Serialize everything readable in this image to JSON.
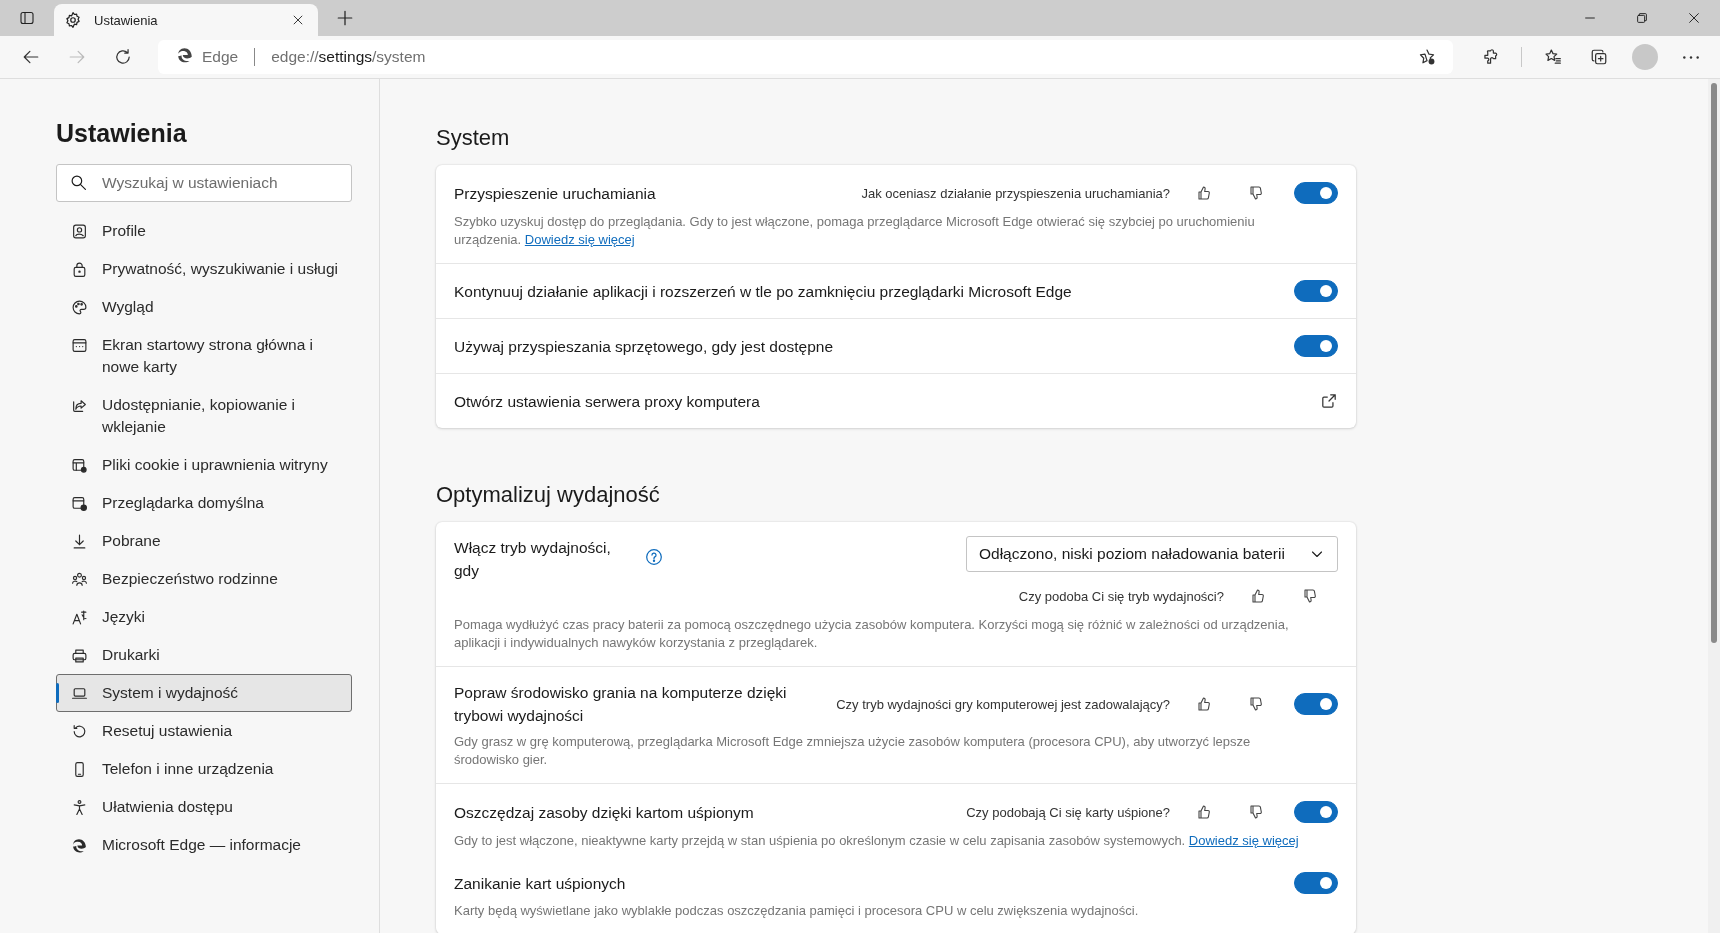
{
  "tab": {
    "title": "Ustawienia",
    "selected": true
  },
  "address_bar": {
    "site_label": "Edge",
    "url_prefix": "edge://",
    "url_host": "settings",
    "url_path": "/system"
  },
  "sidebar": {
    "title": "Ustawienia",
    "search": {
      "placeholder": "Wyszukaj w ustawieniach"
    },
    "items": [
      {
        "label": "Profile",
        "selected": false
      },
      {
        "label": "Prywatność, wyszukiwanie i usługi",
        "selected": false
      },
      {
        "label": "Wygląd",
        "selected": false
      },
      {
        "label": "Ekran startowy strona główna i nowe karty",
        "selected": false
      },
      {
        "label": "Udostępnianie, kopiowanie i wklejanie",
        "selected": false
      },
      {
        "label": "Pliki cookie i uprawnienia witryny",
        "selected": false
      },
      {
        "label": "Przeglądarka domyślna",
        "selected": false
      },
      {
        "label": "Pobrane",
        "selected": false
      },
      {
        "label": "Bezpieczeństwo rodzinne",
        "selected": false
      },
      {
        "label": "Języki",
        "selected": false
      },
      {
        "label": "Drukarki",
        "selected": false
      },
      {
        "label": "System i wydajność",
        "selected": true
      },
      {
        "label": "Resetuj ustawienia",
        "selected": false
      },
      {
        "label": "Telefon i inne urządzenia",
        "selected": false
      },
      {
        "label": "Ułatwienia dostępu",
        "selected": false
      },
      {
        "label": "Microsoft Edge — informacje",
        "selected": false
      }
    ]
  },
  "sections": [
    {
      "title": "System",
      "settings": [
        {
          "kind": "toggle",
          "title": "Przyspieszenie uruchamiania",
          "question": "Jak oceniasz działanie przyspieszenia uruchamiania?",
          "on": true,
          "description": "Szybko uzyskuj dostęp do przeglądania. Gdy to jest włączone, pomaga przeglądarce Microsoft Edge otwierać się szybciej po uruchomieniu urządzenia.",
          "link": "Dowiedz się więcej"
        },
        {
          "kind": "toggle",
          "title": "Kontynuuj działanie aplikacji i rozszerzeń w tle po zamknięciu przeglądarki Microsoft Edge",
          "on": true
        },
        {
          "kind": "toggle",
          "title": "Używaj przyspieszania sprzętowego, gdy jest dostępne",
          "on": true
        },
        {
          "kind": "external",
          "title": "Otwórz ustawienia serwera proxy komputera"
        }
      ]
    },
    {
      "title": "Optymalizuj wydajność",
      "settings": [
        {
          "kind": "dropdown",
          "title": "Włącz tryb wydajności, gdy",
          "value": "Odłączono, niski poziom naładowania baterii",
          "question": "Czy podoba Ci się tryb wydajności?",
          "description": "Pomaga wydłużyć czas pracy baterii za pomocą oszczędnego użycia zasobów komputera. Korzyści mogą się różnić w zależności od urządzenia, aplikacji i indywidualnych nawyków korzystania z przeglądarek."
        },
        {
          "kind": "toggle",
          "title": "Popraw środowisko grania na komputerze dzięki trybowi wydajności",
          "question": "Czy tryb wydajności gry komputerowej jest zadowalający?",
          "on": true,
          "description": "Gdy grasz w grę komputerową, przeglądarka Microsoft Edge zmniejsza użycie zasobów komputera (procesora CPU), aby utworzyć lepsze środowisko gier."
        },
        {
          "kind": "toggle",
          "title": "Oszczędzaj zasoby dzięki kartom uśpionym",
          "question": "Czy podobają Ci się karty uśpione?",
          "on": true,
          "description": "Gdy to jest włączone, nieaktywne karty przejdą w stan uśpienia po określonym czasie w celu zapisania zasobów systemowych.",
          "link": "Dowiedz się więcej"
        },
        {
          "kind": "subtoggle",
          "title": "Zanikanie kart uśpionych",
          "on": true,
          "description": "Karty będą wyświetlane jako wyblakłe podczas oszczędzania pamięci i procesora CPU w celu zwiększenia wydajności."
        }
      ]
    }
  ]
}
